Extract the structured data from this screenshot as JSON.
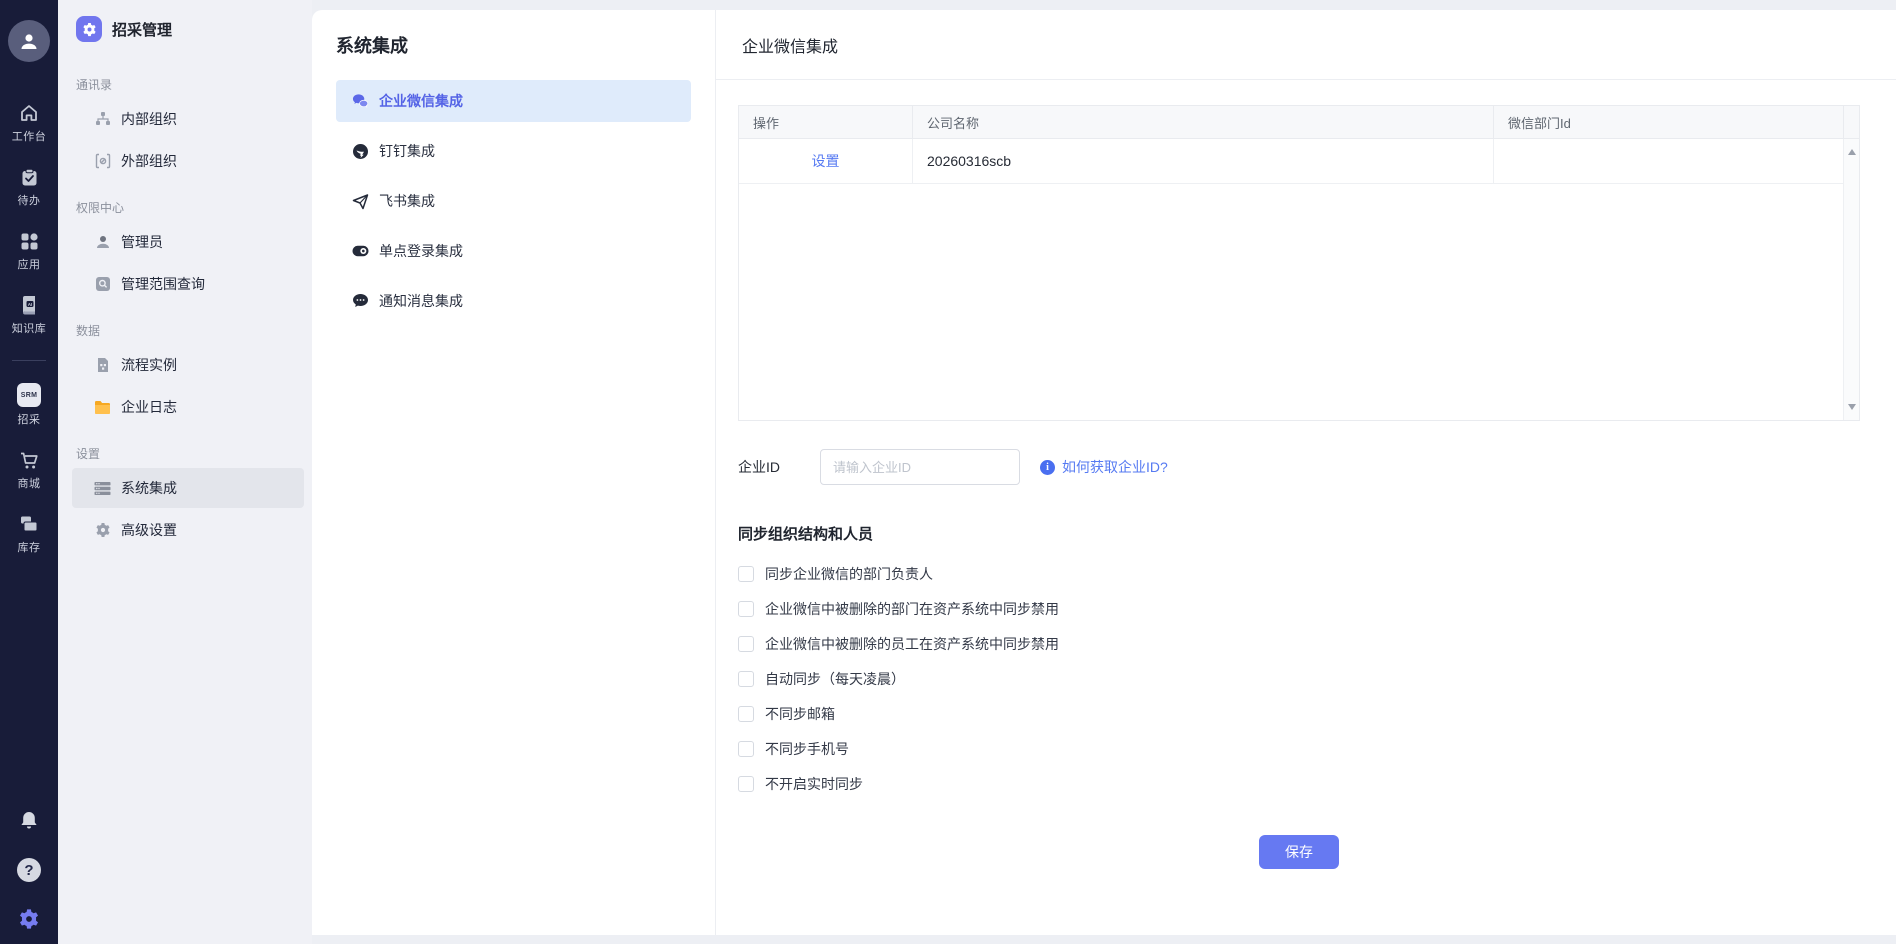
{
  "app": {
    "title": "招采管理",
    "accent_color": "#7176ee",
    "rail_bg": "#181c39",
    "active_blue_bg": "#dfebfb",
    "active_blue_text": "#5463e6",
    "link_color": "#567af2",
    "save_color": "#6679f2"
  },
  "rail": {
    "items": [
      {
        "label": "工作台",
        "icon": "home-icon"
      },
      {
        "label": "待办",
        "icon": "todo-clipboard-icon"
      },
      {
        "label": "应用",
        "icon": "apps-grid-icon"
      },
      {
        "label": "知识库",
        "icon": "ai-knowledge-icon"
      },
      {
        "label": "招采",
        "icon": "srm-badge-icon",
        "badge": "SRM"
      },
      {
        "label": "商城",
        "icon": "cart-icon"
      },
      {
        "label": "库存",
        "icon": "inventory-icon"
      }
    ],
    "bottom_icons": [
      "bell-icon",
      "help-icon",
      "gear-icon"
    ],
    "help_glyph": "?"
  },
  "sidebar": {
    "sections": [
      {
        "label": "通讯录",
        "items": [
          {
            "label": "内部组织",
            "icon": "org-tree-icon"
          },
          {
            "label": "外部组织",
            "icon": "external-org-icon"
          }
        ]
      },
      {
        "label": "权限中心",
        "items": [
          {
            "label": "管理员",
            "icon": "admin-person-icon"
          },
          {
            "label": "管理范围查询",
            "icon": "scope-search-icon"
          }
        ]
      },
      {
        "label": "数据",
        "items": [
          {
            "label": "流程实例",
            "icon": "process-doc-icon"
          },
          {
            "label": "企业日志",
            "icon": "folder-icon",
            "icon_color": "#f6a822"
          }
        ]
      },
      {
        "label": "设置",
        "items": [
          {
            "label": "系统集成",
            "icon": "integration-list-icon",
            "active": true
          },
          {
            "label": "高级设置",
            "icon": "gear-icon"
          }
        ]
      }
    ]
  },
  "integrations": {
    "title": "系统集成",
    "items": [
      {
        "label": "企业微信集成",
        "icon": "wechat-work-icon",
        "active": true
      },
      {
        "label": "钉钉集成",
        "icon": "dingtalk-icon"
      },
      {
        "label": "飞书集成",
        "icon": "feishu-plane-icon"
      },
      {
        "label": "单点登录集成",
        "icon": "sso-toggle-icon"
      },
      {
        "label": "通知消息集成",
        "icon": "message-bubble-icon"
      }
    ]
  },
  "main": {
    "title": "企业微信集成",
    "table": {
      "columns": [
        "操作",
        "公司名称",
        "微信部门Id"
      ],
      "rows": [
        {
          "action": "设置",
          "company": "20260316scb",
          "wechat_dept_id": ""
        }
      ]
    },
    "form": {
      "corp_id_label": "企业ID",
      "corp_id_placeholder": "请输入企业ID",
      "corp_id_value": "",
      "help_link": "如何获取企业ID?"
    },
    "sync_section": {
      "heading": "同步组织结构和人员",
      "checkboxes": [
        {
          "label": "同步企业微信的部门负责人",
          "checked": false
        },
        {
          "label": "企业微信中被删除的部门在资产系统中同步禁用",
          "checked": false
        },
        {
          "label": "企业微信中被删除的员工在资产系统中同步禁用",
          "checked": false
        },
        {
          "label": "自动同步（每天凌晨）",
          "checked": false
        },
        {
          "label": "不同步邮箱",
          "checked": false
        },
        {
          "label": "不同步手机号",
          "checked": false
        },
        {
          "label": "不开启实时同步",
          "checked": false
        }
      ]
    },
    "save_label": "保存"
  }
}
